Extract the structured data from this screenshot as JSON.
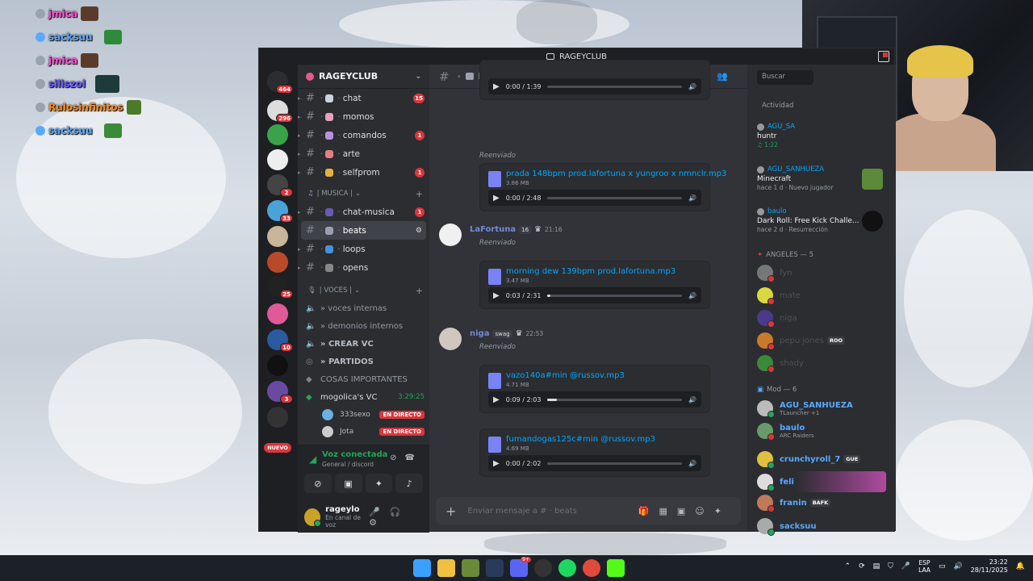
{
  "overlay_chat": [
    {
      "name": "jmica",
      "color": "#ff4fd8"
    },
    {
      "name": "sacksuu",
      "color": "#5aa9ff"
    },
    {
      "name": "jmica",
      "color": "#ff4fd8"
    },
    {
      "name": "siliszol",
      "color": "#6a5cff"
    },
    {
      "name": "Rulosinfinitos",
      "color": "#ff8c1a"
    },
    {
      "name": "sacksuu",
      "color": "#5aa9ff"
    }
  ],
  "window": {
    "title": "RAGEYCLUB"
  },
  "servers": [
    {
      "badge": "464"
    },
    {
      "badge": "296"
    },
    {
      "badge": ""
    },
    {
      "badge": ""
    },
    {
      "badge": "2"
    },
    {
      "badge": "33"
    },
    {
      "badge": ""
    },
    {
      "badge": ""
    },
    {
      "badge": "25"
    },
    {
      "badge": ""
    },
    {
      "badge": "10"
    },
    {
      "badge": ""
    },
    {
      "badge": "3"
    },
    {
      "badge": ""
    }
  ],
  "server_nuevo": "NUEVO",
  "server_name": "RAGEYCLUB",
  "channels": [
    {
      "name": "chat",
      "badge": "15"
    },
    {
      "name": "momos",
      "badge": ""
    },
    {
      "name": "comandos",
      "badge": "1"
    },
    {
      "name": "arte",
      "badge": ""
    },
    {
      "name": "selfprom",
      "badge": "1"
    }
  ],
  "cat_musica": "| MUSICA |",
  "musica_channels": [
    {
      "name": "chat-musica",
      "badge": "1"
    },
    {
      "name": "beats",
      "badge": ""
    },
    {
      "name": "loops",
      "badge": ""
    },
    {
      "name": "opens",
      "badge": ""
    }
  ],
  "cat_voces": "| VOCES |",
  "voice_channels": [
    {
      "name": "» voces internas"
    },
    {
      "name": "» demonios internos"
    },
    {
      "name": "» CREAR VC"
    },
    {
      "name": "» PARTIDOS"
    },
    {
      "name": "COSAS IMPORTANTES"
    }
  ],
  "live_vc": {
    "name": "mogolica's VC",
    "timer": "3:29:25"
  },
  "voice_users": [
    {
      "name": "333sexo",
      "tag": "EN DIRECTO"
    },
    {
      "name": "Jota",
      "tag": "EN DIRECTO"
    }
  ],
  "voice_panel": {
    "status": "Voz conectada",
    "sub": "General / discord"
  },
  "user": {
    "name": "rageylo",
    "status": "En canal de voz"
  },
  "channel_header": {
    "name": "beats"
  },
  "messages": [
    {
      "forwarded": "Reenviado"
    },
    {
      "author": "LaFortuna",
      "tag": "16",
      "time": "21:16",
      "forwarded": "Reenviado"
    },
    {
      "author": "niga",
      "tag": "swag",
      "time": "22:53",
      "forwarded": "Reenviado"
    }
  ],
  "attachments": [
    {
      "fname": "",
      "fsize": "",
      "time": "0:00 / 1:39",
      "progress": 0
    },
    {
      "fname": "prada 148bpm prod.lafortuna x yungroo x nmnclr.mp3",
      "fsize": "3.86 MB",
      "time": "0:00 / 2:48",
      "progress": 0
    },
    {
      "fname": "morning dew 139bpm prod.lafortuna.mp3",
      "fsize": "3.47 MB",
      "time": "0:03 / 2:31",
      "progress": 0.02
    },
    {
      "fname": "vazo140a#min @russov.mp3",
      "fsize": "4.71 MB",
      "time": "0:09 / 2:03",
      "progress": 0.07
    },
    {
      "fname": "fumandogas125c#min @russov.mp3",
      "fsize": "4.69 MB",
      "time": "0:00 / 2:02",
      "progress": 0
    }
  ],
  "composer_placeholder": "Enviar mensaje a # · beats",
  "search_placeholder": "Buscar",
  "activity": {
    "title": "Actividad",
    "cards": [
      {
        "who": "AGU_SA",
        "what": "huntr",
        "meta": "♫ 1:22"
      },
      {
        "who": "AGU_SANHUEZA",
        "what": "Minecraft",
        "meta": "hace 1 d · Nuevo jugador"
      },
      {
        "who": "baulo",
        "what": "Dark Roll: Free Kick Challe...",
        "meta": "hace 2 d · Resurrección"
      }
    ]
  },
  "role_angeles": "ANGELES — 5",
  "angeles": [
    {
      "name": "fyn",
      "tag": ""
    },
    {
      "name": "mate",
      "tag": ""
    },
    {
      "name": "niga",
      "tag": ""
    },
    {
      "name": "pepu jones",
      "tag": "ROO"
    },
    {
      "name": "shady",
      "tag": ""
    }
  ],
  "role_mod": "Mod — 6",
  "mods": [
    {
      "name": "AGU_SANHUEZA",
      "sub": "TLauncher +1",
      "color": "#5aa9ff",
      "tag": ""
    },
    {
      "name": "baulo",
      "sub": "ARC Raiders",
      "color": "#5aa9ff",
      "tag": ""
    },
    {
      "name": "crunchyroll_7",
      "sub": "",
      "color": "#5aa9ff",
      "tag": "GUE"
    },
    {
      "name": "feli",
      "sub": "",
      "color": "#5aa9ff",
      "tag": ""
    },
    {
      "name": "franin",
      "sub": "",
      "color": "#5aa9ff",
      "tag": "BAFK"
    },
    {
      "name": "sacksuu",
      "sub": "",
      "color": "#5aa9ff",
      "tag": ""
    }
  ],
  "tray": {
    "lang_top": "ESP",
    "lang_bottom": "LAA",
    "time": "23:22",
    "date": "28/11/2025"
  }
}
